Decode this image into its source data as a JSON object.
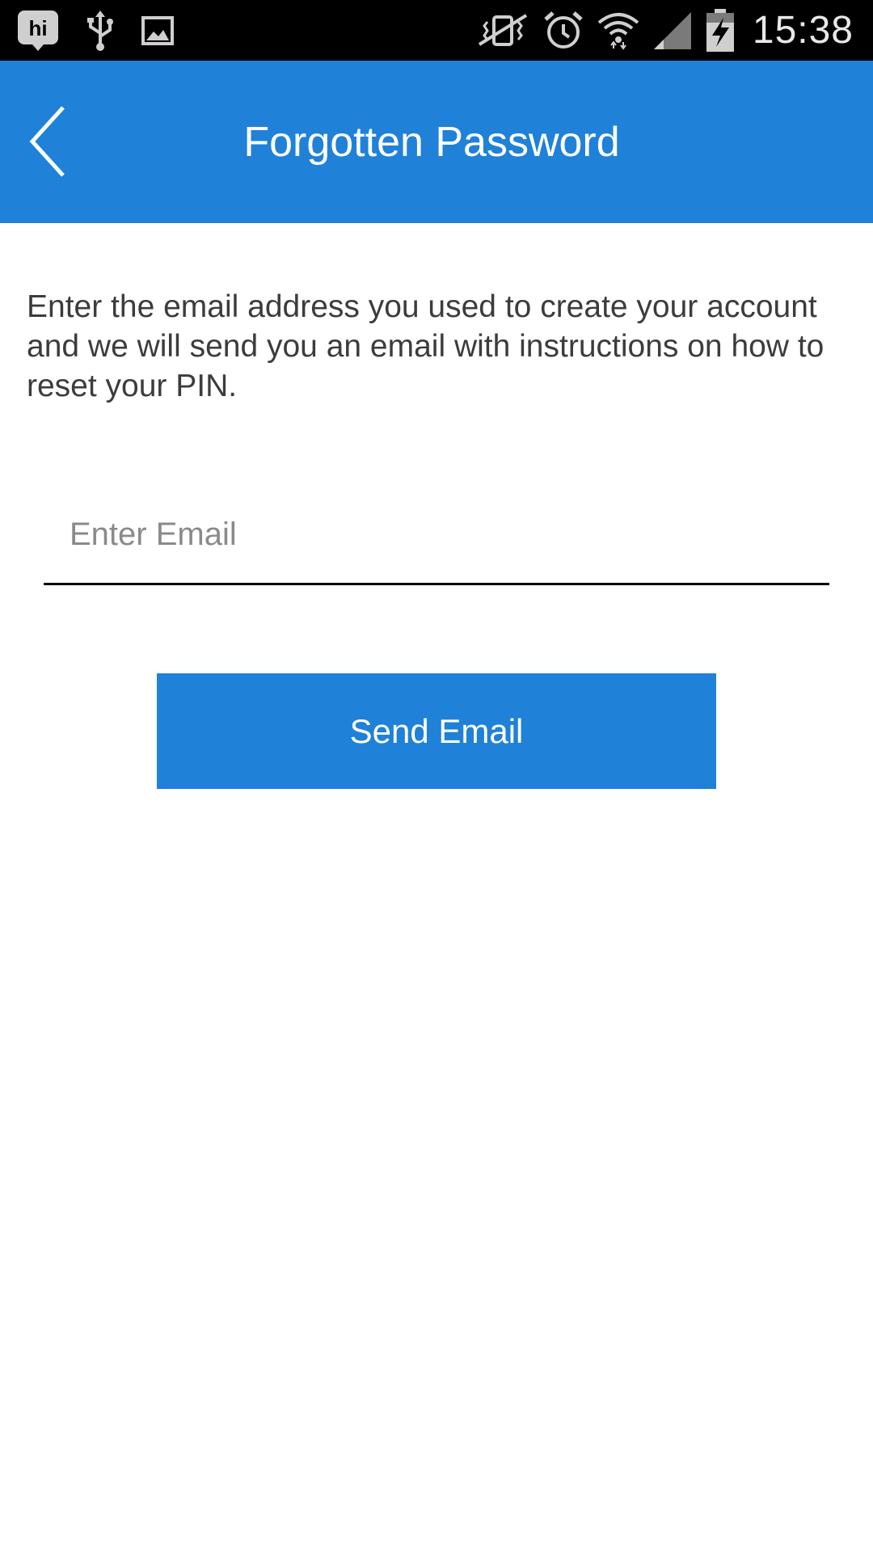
{
  "status_bar": {
    "time": "15:38",
    "left_icons": [
      "hike-messenger-icon",
      "usb-icon",
      "image-icon"
    ],
    "right_icons": [
      "vibrate-icon",
      "alarm-icon",
      "wifi-icon",
      "signal-icon",
      "battery-charging-icon"
    ]
  },
  "header": {
    "title": "Forgotten Password",
    "background": "#1f81d8"
  },
  "main": {
    "instructions": "Enter the email address you used to create your account and we will send you an email with instructions on how to reset your PIN.",
    "email_input": {
      "value": "",
      "placeholder": "Enter Email"
    },
    "send_button_label": "Send Email"
  },
  "colors": {
    "accent": "#1f81d8",
    "text": "#3c3c3c",
    "placeholder": "#8a8a8a"
  }
}
